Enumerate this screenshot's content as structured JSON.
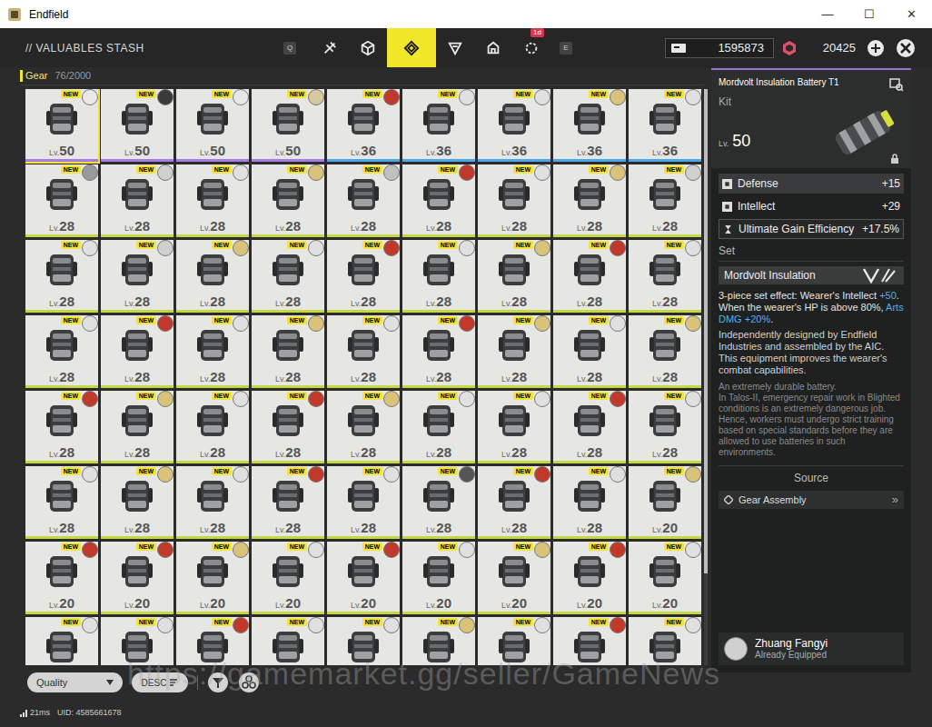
{
  "window": {
    "title": "Endfield",
    "controls": [
      "—",
      "☐",
      "✕"
    ]
  },
  "header": {
    "title": "// VALUABLES STASH",
    "hotkeys": {
      "prev": "Q",
      "next": "E"
    },
    "tabs": [
      {
        "selected": false
      },
      {
        "selected": false
      },
      {
        "selected": true
      },
      {
        "selected": false
      },
      {
        "selected": false
      },
      {
        "selected": false,
        "badge": "1d"
      }
    ],
    "currencies": [
      {
        "amount": "1595873"
      },
      {
        "amount": "20425"
      }
    ]
  },
  "category": {
    "label": "Gear",
    "count": "76/2000"
  },
  "grid": {
    "level_prefix": "Lv.",
    "new_label": "NEW",
    "scrollbar": {
      "level": 0.84
    },
    "items": [
      {
        "level": "50",
        "new": true,
        "avatar_color": "#e8e8e8",
        "color": "#a77be0",
        "selected": true
      },
      {
        "level": "50",
        "new": true,
        "avatar_color": "#3a3a3a",
        "color": "#a77be0",
        "selected": false
      },
      {
        "level": "50",
        "new": true,
        "avatar_color": "#e8e8e8",
        "color": "#a77be0",
        "selected": false
      },
      {
        "level": "50",
        "new": true,
        "avatar_color": "#d8c8a0",
        "color": "#a77be0",
        "selected": false
      },
      {
        "level": "36",
        "new": true,
        "avatar_color": "#c0392b",
        "color": "#4aa8e8",
        "selected": false
      },
      {
        "level": "36",
        "new": true,
        "avatar_color": "#e0e0e0",
        "color": "#4aa8e8",
        "selected": false
      },
      {
        "level": "36",
        "new": true,
        "avatar_color": "#e0e0e0",
        "color": "#4aa8e8",
        "selected": false
      },
      {
        "level": "36",
        "new": true,
        "avatar_color": "#d9c27a",
        "color": "#4aa8e8",
        "selected": false
      },
      {
        "level": "36",
        "new": true,
        "avatar_color": "#e0e0e0",
        "color": "#4aa8e8",
        "selected": false
      },
      {
        "level": "28",
        "new": true,
        "avatar_color": "#9a9a9a",
        "color": "#c5d843",
        "selected": false
      },
      {
        "level": "28",
        "new": true,
        "avatar_color": "#d0d0d0",
        "color": "#c5d843",
        "selected": false
      },
      {
        "level": "28",
        "new": true,
        "avatar_color": "#e0e0e0",
        "color": "#c5d843",
        "selected": false
      },
      {
        "level": "28",
        "new": true,
        "avatar_color": "#d9c27a",
        "color": "#c5d843",
        "selected": false
      },
      {
        "level": "28",
        "new": true,
        "avatar_color": "#c0c0c0",
        "color": "#c5d843",
        "selected": false
      },
      {
        "level": "28",
        "new": true,
        "avatar_color": "#c0392b",
        "color": "#c5d843",
        "selected": false
      },
      {
        "level": "28",
        "new": true,
        "avatar_color": "#e0e0e0",
        "color": "#c5d843",
        "selected": false
      },
      {
        "level": "28",
        "new": true,
        "avatar_color": "#d9c27a",
        "color": "#c5d843",
        "selected": false
      },
      {
        "level": "28",
        "new": true,
        "avatar_color": "#d0d0d0",
        "color": "#c5d843",
        "selected": false
      },
      {
        "level": "28",
        "new": true,
        "avatar_color": "#e0e0e0",
        "color": "#c5d843",
        "selected": false
      },
      {
        "level": "28",
        "new": true,
        "avatar_color": "#d0d0d0",
        "color": "#c5d843",
        "selected": false
      },
      {
        "level": "28",
        "new": true,
        "avatar_color": "#d9c27a",
        "color": "#c5d843",
        "selected": false
      },
      {
        "level": "28",
        "new": true,
        "avatar_color": "#e0e0e0",
        "color": "#c5d843",
        "selected": false
      },
      {
        "level": "28",
        "new": true,
        "avatar_color": "#c0392b",
        "color": "#c5d843",
        "selected": false
      },
      {
        "level": "28",
        "new": true,
        "avatar_color": "#e0e0e0",
        "color": "#c5d843",
        "selected": false
      },
      {
        "level": "28",
        "new": true,
        "avatar_color": "#d9c27a",
        "color": "#c5d843",
        "selected": false
      },
      {
        "level": "28",
        "new": true,
        "avatar_color": "#c0392b",
        "color": "#c5d843",
        "selected": false
      },
      {
        "level": "28",
        "new": true,
        "avatar_color": "#e0e0e0",
        "color": "#c5d843",
        "selected": false
      },
      {
        "level": "28",
        "new": true,
        "avatar_color": "#e0e0e0",
        "color": "#c5d843",
        "selected": false
      },
      {
        "level": "28",
        "new": true,
        "avatar_color": "#c0392b",
        "color": "#c5d843",
        "selected": false
      },
      {
        "level": "28",
        "new": true,
        "avatar_color": "#e0e0e0",
        "color": "#c5d843",
        "selected": false
      },
      {
        "level": "28",
        "new": true,
        "avatar_color": "#d9c27a",
        "color": "#c5d843",
        "selected": false
      },
      {
        "level": "28",
        "new": true,
        "avatar_color": "#e0e0e0",
        "color": "#c5d843",
        "selected": false
      },
      {
        "level": "28",
        "new": true,
        "avatar_color": "#c0392b",
        "color": "#c5d843",
        "selected": false
      },
      {
        "level": "28",
        "new": true,
        "avatar_color": "#d9c27a",
        "color": "#c5d843",
        "selected": false
      },
      {
        "level": "28",
        "new": true,
        "avatar_color": "#e0e0e0",
        "color": "#c5d843",
        "selected": false
      },
      {
        "level": "28",
        "new": true,
        "avatar_color": "#d9c27a",
        "color": "#c5d843",
        "selected": false
      },
      {
        "level": "28",
        "new": true,
        "avatar_color": "#c0392b",
        "color": "#c5d843",
        "selected": false
      },
      {
        "level": "28",
        "new": true,
        "avatar_color": "#d9c27a",
        "color": "#c5d843",
        "selected": false
      },
      {
        "level": "28",
        "new": true,
        "avatar_color": "#e0e0e0",
        "color": "#c5d843",
        "selected": false
      },
      {
        "level": "28",
        "new": true,
        "avatar_color": "#c0392b",
        "color": "#c5d843",
        "selected": false
      },
      {
        "level": "28",
        "new": true,
        "avatar_color": "#d9c27a",
        "color": "#c5d843",
        "selected": false
      },
      {
        "level": "28",
        "new": true,
        "avatar_color": "#e0e0e0",
        "color": "#c5d843",
        "selected": false
      },
      {
        "level": "28",
        "new": true,
        "avatar_color": "#e0e0e0",
        "color": "#c5d843",
        "selected": false
      },
      {
        "level": "28",
        "new": true,
        "avatar_color": "#c0392b",
        "color": "#c5d843",
        "selected": false
      },
      {
        "level": "28",
        "new": true,
        "avatar_color": "#e0e0e0",
        "color": "#c5d843",
        "selected": false
      },
      {
        "level": "28",
        "new": true,
        "avatar_color": "#e0e0e0",
        "color": "#c5d843",
        "selected": false
      },
      {
        "level": "28",
        "new": true,
        "avatar_color": "#d9c27a",
        "color": "#c5d843",
        "selected": false
      },
      {
        "level": "28",
        "new": true,
        "avatar_color": "#e0e0e0",
        "color": "#c5d843",
        "selected": false
      },
      {
        "level": "28",
        "new": true,
        "avatar_color": "#c0392b",
        "color": "#c5d843",
        "selected": false
      },
      {
        "level": "28",
        "new": true,
        "avatar_color": "#e0e0e0",
        "color": "#c5d843",
        "selected": false
      },
      {
        "level": "28",
        "new": true,
        "avatar_color": "#555555",
        "color": "#c5d843",
        "selected": false
      },
      {
        "level": "28",
        "new": true,
        "avatar_color": "#c0392b",
        "color": "#c5d843",
        "selected": false
      },
      {
        "level": "28",
        "new": true,
        "avatar_color": "#e0e0e0",
        "color": "#c5d843",
        "selected": false
      },
      {
        "level": "20",
        "new": true,
        "avatar_color": "#d9c27a",
        "color": "#c5d843",
        "selected": false
      },
      {
        "level": "20",
        "new": true,
        "avatar_color": "#c0392b",
        "color": "#c5d843",
        "selected": false
      },
      {
        "level": "20",
        "new": true,
        "avatar_color": "#c0392b",
        "color": "#c5d843",
        "selected": false
      },
      {
        "level": "20",
        "new": true,
        "avatar_color": "#d9c27a",
        "color": "#c5d843",
        "selected": false
      },
      {
        "level": "20",
        "new": true,
        "avatar_color": "#e0e0e0",
        "color": "#c5d843",
        "selected": false
      },
      {
        "level": "20",
        "new": true,
        "avatar_color": "#c0392b",
        "color": "#c5d843",
        "selected": false
      },
      {
        "level": "20",
        "new": true,
        "avatar_color": "#e0e0e0",
        "color": "#c5d843",
        "selected": false
      },
      {
        "level": "20",
        "new": true,
        "avatar_color": "#d9c27a",
        "color": "#c5d843",
        "selected": false
      },
      {
        "level": "20",
        "new": true,
        "avatar_color": "#c0392b",
        "color": "#c5d843",
        "selected": false
      },
      {
        "level": "20",
        "new": true,
        "avatar_color": "#e0e0e0",
        "color": "#c5d843",
        "selected": false
      },
      {
        "new": true,
        "avatar_color": "#e0e0e0",
        "color": "#c5d843",
        "selected": false
      },
      {
        "new": true,
        "avatar_color": "#e0e0e0",
        "color": "#c5d843",
        "selected": false
      },
      {
        "new": true,
        "avatar_color": "#c0392b",
        "color": "#c5d843",
        "selected": false
      },
      {
        "new": true,
        "avatar_color": "#e0e0e0",
        "color": "#c5d843",
        "selected": false
      },
      {
        "new": true,
        "avatar_color": "#e0e0e0",
        "color": "#c5d843",
        "selected": false
      },
      {
        "new": true,
        "avatar_color": "#d9c27a",
        "color": "#c5d843",
        "selected": false
      },
      {
        "new": true,
        "avatar_color": "#e0e0e0",
        "color": "#c5d843",
        "selected": false
      },
      {
        "new": true,
        "avatar_color": "#c0392b",
        "color": "#c5d843",
        "selected": false
      },
      {
        "new": true,
        "avatar_color": "#e0e0e0",
        "color": "#c5d843",
        "selected": false
      }
    ]
  },
  "detail": {
    "name": "Mordvolt Insulation Battery T1",
    "type": "Kit",
    "level_prefix": "Lv.",
    "level": "50",
    "stats": [
      {
        "label": "Defense",
        "value": "+15",
        "kind": "attribute",
        "highlight": true
      },
      {
        "label": "Intellect",
        "value": "+29",
        "kind": "attribute",
        "highlight": false
      },
      {
        "label": "Ultimate Gain Efficiency",
        "value": "+17.5%",
        "kind": "passive",
        "highlight": false
      }
    ],
    "set": {
      "label": "Set",
      "name": "Mordvolt Insulation",
      "effect": [
        [
          {
            "text": "3-piece set effect: Wearer's Intellect ",
            "highlight": false
          },
          {
            "text": "+50",
            "highlight": true
          },
          {
            "text": ".",
            "highlight": false
          }
        ],
        [
          {
            "text": "When the wearer's HP is above 80%, ",
            "highlight": false
          },
          {
            "text": "Arts DMG +20%",
            "highlight": true
          },
          {
            "text": ".",
            "highlight": false
          }
        ]
      ]
    },
    "description": "Independently designed by Endfield Industries and assembled by the AIC. This equipment improves the wearer's combat capabilities.",
    "lore": [
      "An extremely durable battery.",
      "In Talos-II, emergency repair work in Blighted conditions is an extremely dangerous job. Hence, workers must undergo strict training based on special standards before they are allowed to use batteries in such environments."
    ],
    "source": {
      "label": "Source",
      "items": [
        {
          "label": "Gear Assembly",
          "arrow": "»"
        }
      ]
    },
    "equipped": {
      "name": "Zhuang Fangyi",
      "status": "Already Equipped"
    }
  },
  "toolbar": {
    "sort_field": "Quality",
    "order": "DESC"
  },
  "status_bar": {
    "ping": "21ms",
    "uid": "UID: 4585661678"
  },
  "watermark": "https://gamemarket.gg/seller/GameNews"
}
